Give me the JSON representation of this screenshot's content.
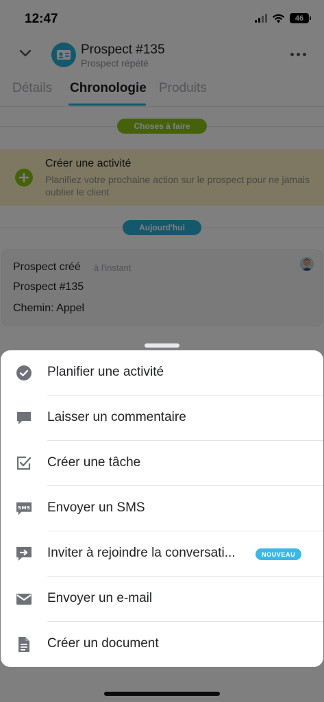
{
  "status_bar": {
    "time": "12:47",
    "battery": "46"
  },
  "header": {
    "title": "Prospect #135",
    "subtitle": "Prospect répété"
  },
  "tabs": [
    {
      "label": "Détails",
      "active": false
    },
    {
      "label": "Chronologie",
      "active": true
    },
    {
      "label": "Produits",
      "active": false
    }
  ],
  "timeline": {
    "todo_pill": "Choses à faire",
    "create_activity": {
      "title": "Créer une activité",
      "description": "Planifiez votre prochaine action sur le prospect pour ne jamais oublier le client"
    },
    "today_pill": "Aujourd'hui",
    "activity": {
      "title": "Prospect créé",
      "time": "à l'instant",
      "line1": "Prospect #135",
      "line2": "Chemin: Appel"
    }
  },
  "sheet": {
    "items": [
      {
        "label": "Planifier une activité",
        "icon": "check-circle-icon"
      },
      {
        "label": "Laisser un commentaire",
        "icon": "comment-icon"
      },
      {
        "label": "Créer une tâche",
        "icon": "task-checkbox-icon"
      },
      {
        "label": "Envoyer un SMS",
        "icon": "sms-icon",
        "icon_text": "SMS"
      },
      {
        "label": "Inviter à rejoindre la conversati...",
        "icon": "invite-chat-icon",
        "badge": "NOUVEAU"
      },
      {
        "label": "Envoyer un e-mail",
        "icon": "mail-icon"
      },
      {
        "label": "Créer un document",
        "icon": "document-icon"
      }
    ]
  },
  "colors": {
    "accent": "#2bb0d8",
    "todo_pill": "#8bc417",
    "today_pill": "#2bb0d8",
    "badge": "#39b8e5",
    "todo_card_bg": "#fdf1c4",
    "icon_gray": "#6e7278"
  }
}
